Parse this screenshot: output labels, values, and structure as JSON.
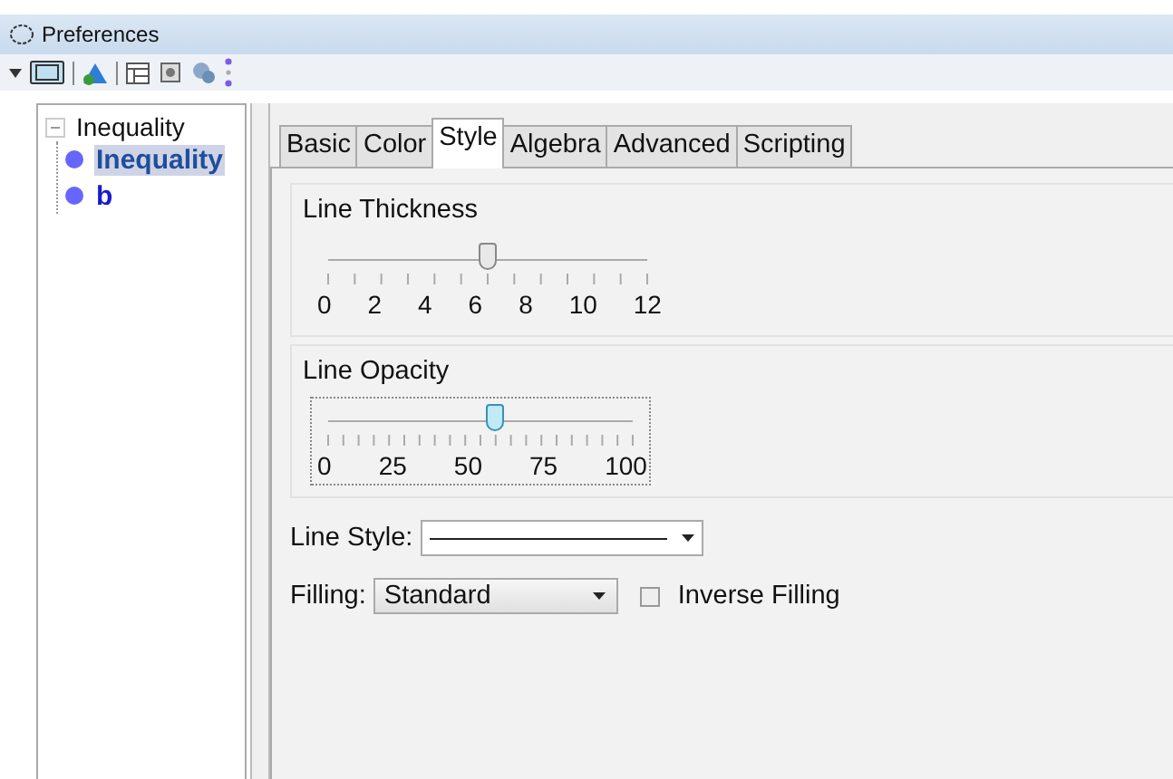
{
  "window": {
    "title": "Preferences"
  },
  "tree": {
    "label": "Inequality",
    "expanded": true,
    "children": [
      {
        "label": "Inequality",
        "selected": true
      },
      {
        "label": "b",
        "selected": false
      }
    ]
  },
  "tabs": [
    {
      "label": "Basic",
      "selected": false
    },
    {
      "label": "Color",
      "selected": false
    },
    {
      "label": "Style",
      "selected": true
    },
    {
      "label": "Algebra",
      "selected": false
    },
    {
      "label": "Advanced",
      "selected": false
    },
    {
      "label": "Scripting",
      "selected": false
    }
  ],
  "sliders": [
    {
      "kind": "thickness",
      "title": "Line Thickness",
      "level": 0.5,
      "tick_labels": [
        "0",
        "2",
        "4",
        "6",
        "8",
        "10",
        "12"
      ],
      "focused": false
    },
    {
      "kind": "opacity",
      "title": "Line Opacity",
      "level": 0.55,
      "tick_labels": [
        "0",
        "25",
        "50",
        "75",
        "100"
      ],
      "focused": true
    }
  ],
  "line_style": {
    "label": "Line Style:"
  },
  "filling": {
    "label": "Filling:",
    "value": "Standard"
  },
  "inverse_filling": {
    "label": "Inverse Filling",
    "checked": false
  }
}
